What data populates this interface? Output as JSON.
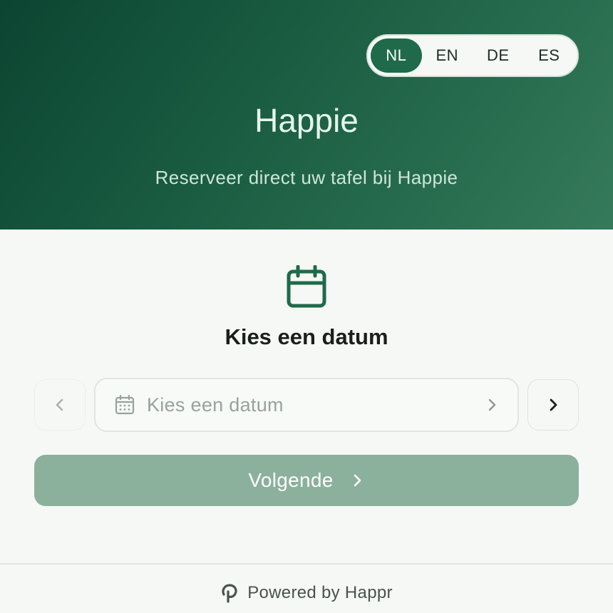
{
  "languages": {
    "options": [
      "NL",
      "EN",
      "DE",
      "ES"
    ],
    "selected": "NL"
  },
  "header": {
    "title": "Happie",
    "subtitle": "Reserveer direct uw tafel bij Happie"
  },
  "main": {
    "section_title": "Kies een datum",
    "date_field_placeholder": "Kies een datum",
    "next_button_label": "Volgende"
  },
  "footer": {
    "text": "Powered by Happr"
  },
  "icons": {
    "section_icon": "calendar-icon",
    "field_icon": "calendar-grid-icon",
    "prev": "chevron-left-icon",
    "next": "chevron-right-icon",
    "footer_logo": "happr-logo-icon"
  },
  "colors": {
    "brand_dark": "#0c4532",
    "brand": "#1f6a4b",
    "button_disabled": "#8bb19d",
    "background": "#f6f8f6"
  }
}
